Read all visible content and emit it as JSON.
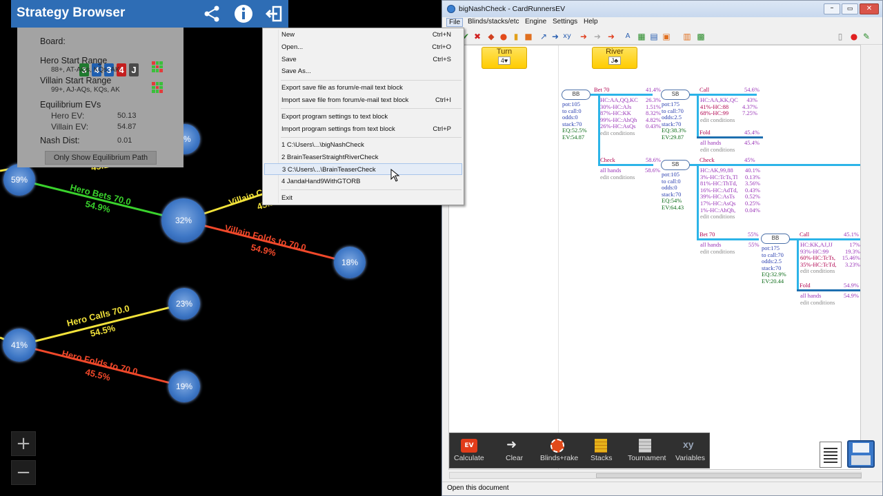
{
  "strategy_browser": {
    "title": "Strategy Browser",
    "board_label": "Board:",
    "board_cards": [
      {
        "rank": "3",
        "color": "#1f7a2e"
      },
      {
        "rank": "4",
        "color": "#1f5fb0"
      },
      {
        "rank": "3",
        "color": "#1f5fb0"
      },
      {
        "rank": "4",
        "color": "#c41f1f"
      },
      {
        "rank": "J",
        "color": "#4a4a4a"
      }
    ],
    "hero_range_label": "Hero Start Range",
    "hero_range": "88+, AT-AQs, KQs, AK",
    "villain_range_label": "Villain Start Range",
    "villain_range": "99+, AJ-AQs, KQs, AK",
    "eq_label": "Equilibrium EVs",
    "hero_ev_label": "Hero EV:",
    "hero_ev": "50.13",
    "villain_ev_label": "Villain EV:",
    "villain_ev": "54.87",
    "nash_label": "Nash Dist:",
    "nash_value": "0.01",
    "eq_button": "Only Show Equilibrium Path",
    "zoom_in": "+",
    "zoom_out": "−"
  },
  "tree": {
    "nodes": [
      "59%",
      "32%",
      "18%",
      "23%",
      "41%",
      "19%",
      "6%"
    ],
    "edges": [
      {
        "label": "Hero Bets 70.0",
        "pct": "54.9%"
      },
      {
        "label": "Villain C",
        "pct": "45.1%"
      },
      {
        "label": "Villain Folds to 70.0",
        "pct": "54.9%"
      },
      {
        "label": "Hero Calls 70.0",
        "pct": "54.5%"
      },
      {
        "label": "Hero Folds to 70.0",
        "pct": "45.5%"
      },
      {
        "label": "",
        "pct": "45.1"
      }
    ]
  },
  "file_menu": {
    "items": [
      {
        "label": "New",
        "key": "Ctrl+N"
      },
      {
        "label": "Open...",
        "key": "Ctrl+O"
      },
      {
        "label": "Save",
        "key": "Ctrl+S"
      },
      {
        "label": "Save As...",
        "key": ""
      },
      {
        "label": "Export save file as forum/e-mail text block",
        "key": ""
      },
      {
        "label": "Import save file from forum/e-mail text block",
        "key": "Ctrl+I"
      },
      {
        "label": "Export program settings to text block",
        "key": ""
      },
      {
        "label": "Import program settings from text block",
        "key": "Ctrl+P"
      },
      {
        "label": "1 C:\\Users\\...\\bigNashCheck",
        "key": ""
      },
      {
        "label": "2 BrainTeaserStraightRiverCheck",
        "key": ""
      },
      {
        "label": "3 C:\\Users\\...\\BrainTeaserCheck",
        "key": ""
      },
      {
        "label": "4 JandaHand9WithGTORB",
        "key": ""
      },
      {
        "label": "Exit",
        "key": ""
      }
    ]
  },
  "app": {
    "title": "bigNashCheck - CardRunnersEV",
    "menu": [
      "File",
      "Blinds/stacks/etc",
      "Engine",
      "Settings",
      "Help"
    ],
    "status": "Open this document",
    "turn_label": "Turn",
    "turn_card": "4♥",
    "river_label": "River",
    "river_card": "J♣",
    "bottom_buttons": [
      "Calculate",
      "Clear",
      "Blinds+rake",
      "Stacks",
      "Tournament",
      "Variables"
    ],
    "ev_badge": "EV"
  },
  "game_tree": {
    "bb1": {
      "name": "BB",
      "lines": [
        "pot:105",
        "to call:0",
        "odds:0",
        "stack:70",
        "EQ:52.5%",
        "EV:54.87"
      ]
    },
    "bet70": {
      "label": "Bet 70",
      "pct": "41.4%",
      "lines": [
        [
          "HC:AA,QQ,KC",
          "26.3%"
        ],
        [
          "30%-HC:AJs",
          "1.51%"
        ],
        [
          "87%-HC:KK",
          "8.32%"
        ],
        [
          "99%-HC:AhQh",
          "4.82%"
        ],
        [
          "26%-HC:AsQs",
          "0.43%"
        ]
      ],
      "edit": "edit conditions"
    },
    "sb1": {
      "name": "SB",
      "lines": [
        "pot:175",
        "to call:70",
        "odds:2.5",
        "stack:70",
        "EQ:38.3%",
        "EV:29.87"
      ]
    },
    "call1": {
      "label": "Call",
      "pct": "54.6%",
      "lines": [
        [
          "HC:AA,KK,QC",
          "43%"
        ],
        [
          "41%-HC:88",
          "4.37%"
        ],
        [
          "68%-HC:99",
          "7.25%"
        ]
      ],
      "edit": "edit conditions"
    },
    "fold1": {
      "label": "Fold",
      "pct": "45.4%",
      "hands": "all hands",
      "hands_pct": "45.4%",
      "edit": "edit conditions"
    },
    "check1": {
      "label": "Check",
      "pct": "58.6%",
      "hands": "all hands",
      "hands_pct": "58.6%",
      "edit": "edit conditions"
    },
    "sb2": {
      "name": "SB",
      "lines": [
        "pot:105",
        "to call:0",
        "odds:0",
        "stack:70",
        "EQ:54%",
        "EV:64.43"
      ]
    },
    "check2": {
      "label": "Check",
      "pct": "45%",
      "lines": [
        [
          "HC:AK,99,88",
          "40.1%"
        ],
        [
          "3%-HC:TcTs,Tl",
          "0.13%"
        ],
        [
          "81%-HC:ThTd,",
          "3.56%"
        ],
        [
          "16%-HC:AdTd,",
          "0.43%"
        ],
        [
          "39%-HC:AsTs",
          "0.52%"
        ],
        [
          "17%-HC:AsQs",
          "0.25%"
        ],
        [
          "1%-HC:AhQh,",
          "0.04%"
        ]
      ],
      "edit": "edit conditions"
    },
    "bet70b": {
      "label": "Bet 70",
      "pct": "55%",
      "hands": "all hands",
      "hands_pct": "55%",
      "edit": "edit conditions"
    },
    "bb2": {
      "name": "BB",
      "lines": [
        "pot:175",
        "to call:70",
        "odds:2.5",
        "stack:70",
        "EQ:32.9%",
        "EV:20.44"
      ]
    },
    "call2": {
      "label": "Call",
      "pct": "45.1%",
      "lines": [
        [
          "HC:KK,AJ,JJ",
          "17%"
        ],
        [
          "93%-HC:99",
          "19.3%"
        ],
        [
          "60%-HC:TcTs,",
          "15.46%"
        ],
        [
          "35%-HC:TcTd,",
          "3.23%"
        ]
      ],
      "edit": "edit conditions"
    },
    "fold2": {
      "label": "Fold",
      "pct": "54.9%",
      "hands": "all hands",
      "hands_pct": "54.9%",
      "edit": "edit conditions"
    }
  }
}
